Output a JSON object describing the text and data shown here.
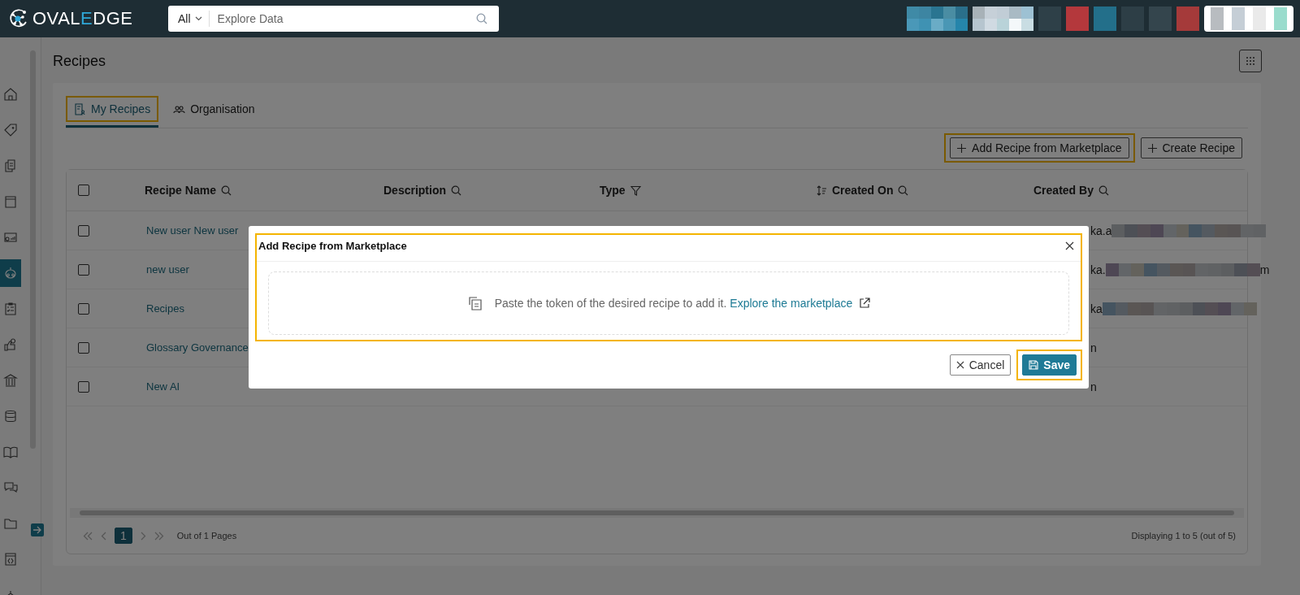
{
  "topbar": {
    "logo": {
      "text": "OVALEDGE"
    },
    "search": {
      "scope": "All",
      "placeholder": "Explore Data"
    }
  },
  "sidebar": {
    "items": [
      {
        "selected": false
      },
      {
        "selected": false
      },
      {
        "selected": false
      },
      {
        "selected": false
      },
      {
        "selected": false
      },
      {
        "selected": true
      },
      {
        "selected": false
      },
      {
        "selected": false
      },
      {
        "selected": false
      },
      {
        "selected": false
      },
      {
        "selected": false
      },
      {
        "selected": false
      },
      {
        "selected": false
      },
      {
        "selected": false
      },
      {
        "selected": false
      }
    ]
  },
  "page": {
    "title": "Recipes"
  },
  "tabs": [
    {
      "label": "My Recipes",
      "selected": true,
      "highlighted": true
    },
    {
      "label": "Organisation",
      "selected": false,
      "highlighted": false
    }
  ],
  "actions": [
    {
      "label": "Add Recipe from Marketplace",
      "highlighted": true
    },
    {
      "label": "Create Recipe",
      "highlighted": false
    }
  ],
  "table": {
    "all_checked": false,
    "columns": [
      {
        "label": "Recipe Name",
        "kind": "search"
      },
      {
        "label": "Description",
        "kind": "search"
      },
      {
        "label": "Type",
        "kind": "filter"
      },
      {
        "label": "Created On",
        "kind": "sort-search"
      },
      {
        "label": "Created By",
        "kind": "search"
      }
    ],
    "rows": [
      {
        "checked": false,
        "name": "New user New user",
        "created_by": [
          "ka.a"
        ],
        "redacted": true
      },
      {
        "checked": false,
        "name": "new user",
        "created_by": [
          "ka.",
          "m"
        ],
        "redacted": true
      },
      {
        "checked": false,
        "name": "Recipes",
        "created_by": [
          "ka"
        ],
        "redacted": true
      },
      {
        "checked": false,
        "name": "Glossary Governance",
        "created_by": [
          "n"
        ],
        "redacted": false
      },
      {
        "checked": false,
        "name": "New AI",
        "created_by": [
          "n"
        ],
        "redacted": false
      }
    ]
  },
  "pagination": {
    "pages": [
      {
        "label": "1",
        "selected": true
      }
    ],
    "summary": "Out of 1 Pages",
    "displaying": "Displaying 1 to 5 (out of 5)"
  },
  "modal": {
    "title": "Add Recipe from Marketplace",
    "highlighted": true,
    "message": "Paste the token of the desired recipe to add it.",
    "link": "Explore the marketplace",
    "buttons": [
      {
        "label": "Cancel",
        "kind": "cancel",
        "highlighted": false
      },
      {
        "label": "Save",
        "kind": "save",
        "highlighted": true
      }
    ]
  }
}
